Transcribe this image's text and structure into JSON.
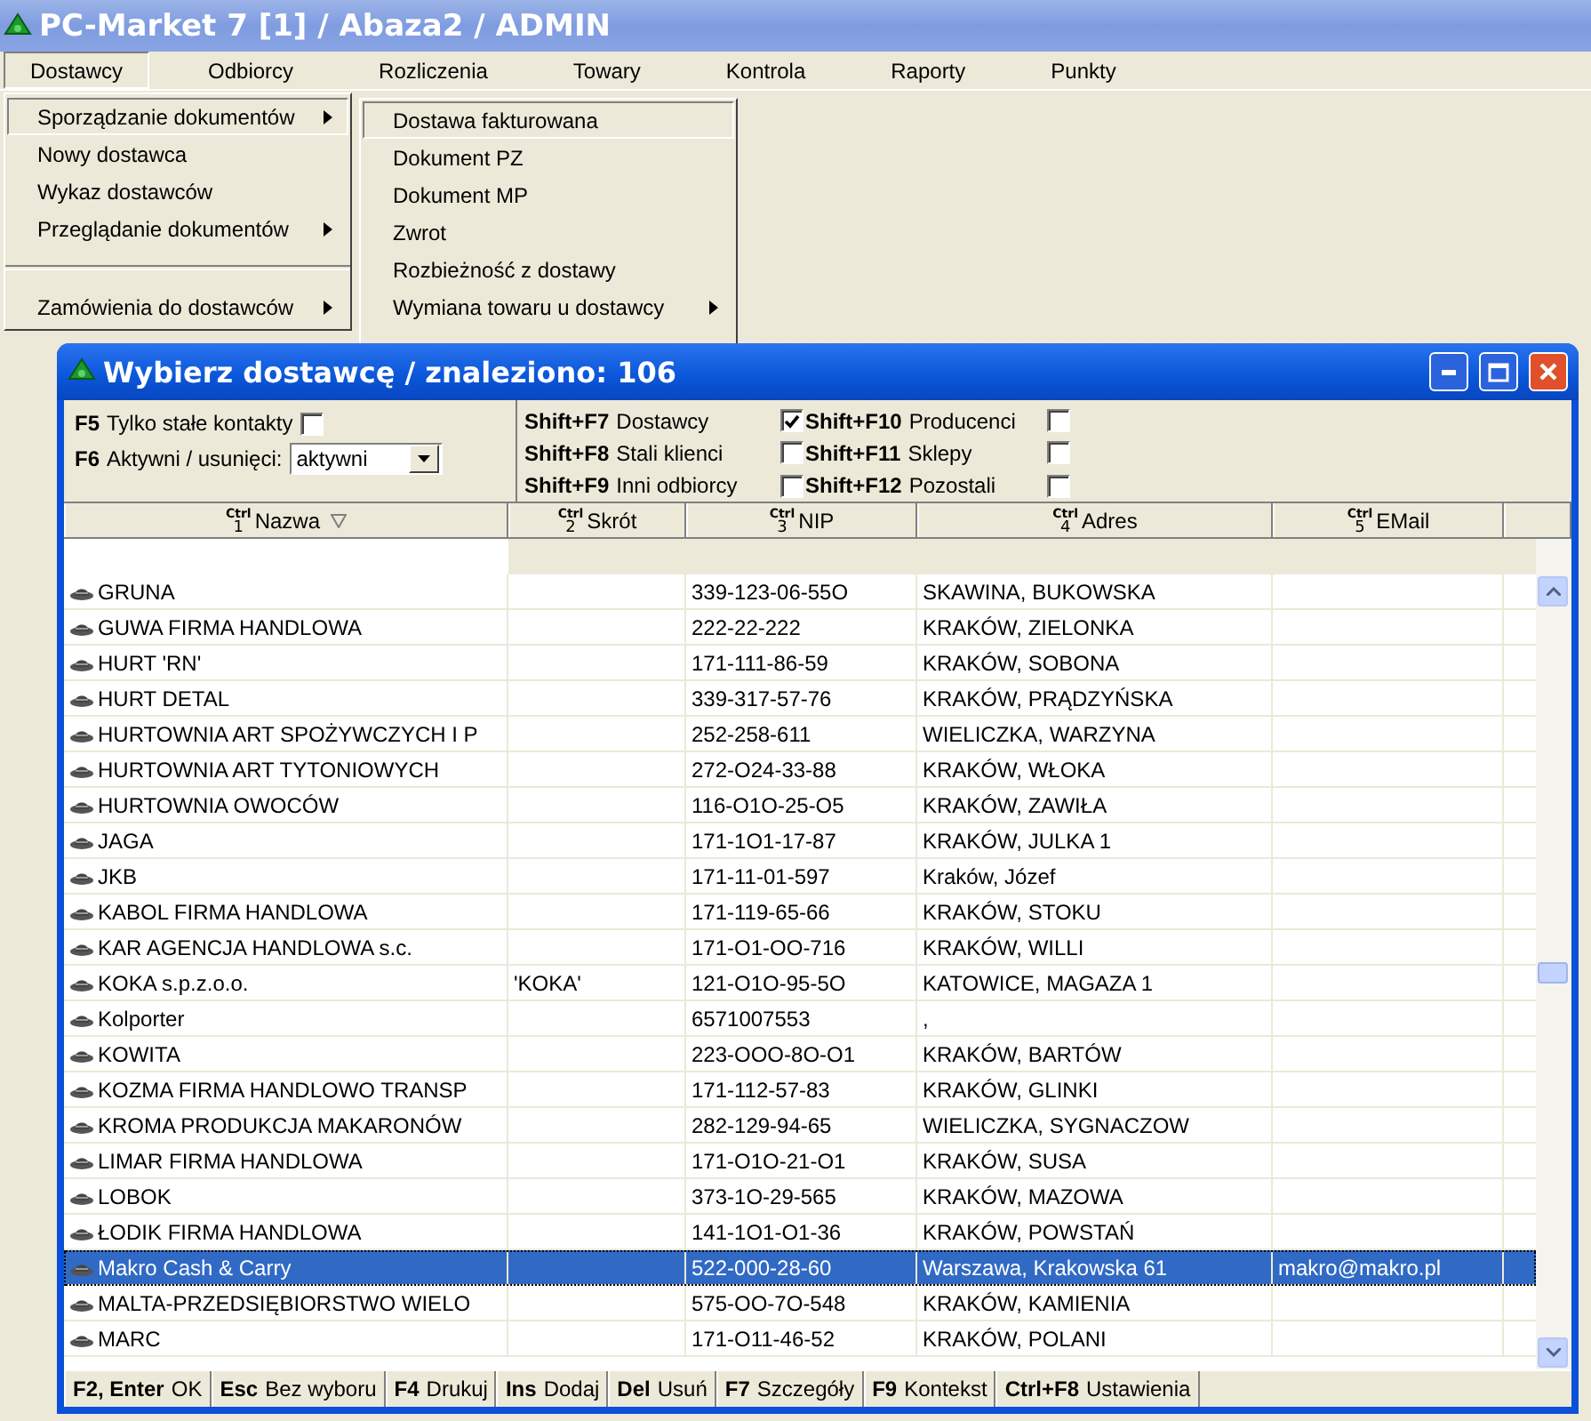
{
  "window": {
    "title": "PC-Market 7 [1] / Abaza2 / ADMIN"
  },
  "menubar": [
    {
      "label": "Dostawcy",
      "selected": true
    },
    {
      "label": "Odbiorcy",
      "selected": false
    },
    {
      "label": "Rozliczenia",
      "selected": false
    },
    {
      "label": "Towary",
      "selected": false
    },
    {
      "label": "Kontrola",
      "selected": false
    },
    {
      "label": "Raporty",
      "selected": false
    },
    {
      "label": "Punkty",
      "selected": false
    }
  ],
  "menu": [
    {
      "kind": "item",
      "label": "Sporządzanie dokumentów",
      "submenu": true,
      "selected": true
    },
    {
      "kind": "item",
      "label": "Nowy dostawca",
      "submenu": false,
      "selected": false
    },
    {
      "kind": "item",
      "label": "Wykaz dostawców",
      "submenu": false,
      "selected": false
    },
    {
      "kind": "item",
      "label": "Przeglądanie dokumentów",
      "submenu": true,
      "selected": false
    },
    {
      "kind": "separator"
    },
    {
      "kind": "item",
      "label": "Zamówienia do dostawców",
      "submenu": true,
      "selected": false
    }
  ],
  "submenu": [
    {
      "label": "Dostawa fakturowana",
      "submenu": false,
      "selected": true
    },
    {
      "label": "Dokument PZ",
      "submenu": false,
      "selected": false
    },
    {
      "label": "Dokument MP",
      "submenu": false,
      "selected": false
    },
    {
      "label": "Zwrot",
      "submenu": false,
      "selected": false
    },
    {
      "label": "Rozbieżność z dostawy",
      "submenu": false,
      "selected": false
    },
    {
      "label": "Wymiana towaru u dostawcy",
      "submenu": true,
      "selected": false
    }
  ],
  "dialog": {
    "title": "Wybierz dostawcę / znaleziono: 106",
    "filters": {
      "only_constant": {
        "key": "F5",
        "label": "Tylko stałe kontakty",
        "checked": false
      },
      "active": {
        "key": "F6",
        "label": "Aktywni / usunięci:",
        "value": "aktywni"
      },
      "types": [
        {
          "key": "Shift+F7",
          "label": "Dostawcy",
          "checked": true
        },
        {
          "key": "Shift+F10",
          "label": "Producenci",
          "checked": false
        },
        {
          "key": "Shift+F8",
          "label": "Stali klienci",
          "checked": false
        },
        {
          "key": "Shift+F11",
          "label": "Sklepy",
          "checked": false
        },
        {
          "key": "Shift+F9",
          "label": "Inni odbiorcy",
          "checked": false
        },
        {
          "key": "Shift+F12",
          "label": "Pozostali",
          "checked": false
        }
      ]
    },
    "columns": [
      {
        "ctrl": "Ctrl",
        "num": "1",
        "label": "Nazwa",
        "sorted": true
      },
      {
        "ctrl": "Ctrl",
        "num": "2",
        "label": "Skrót",
        "sorted": false
      },
      {
        "ctrl": "Ctrl",
        "num": "3",
        "label": "NIP",
        "sorted": false
      },
      {
        "ctrl": "Ctrl",
        "num": "4",
        "label": "Adres",
        "sorted": false
      },
      {
        "ctrl": "Ctrl",
        "num": "5",
        "label": "EMail",
        "sorted": false
      }
    ],
    "rows": [
      {
        "cells": [
          "GRUNA",
          "",
          "339-123-06-55O",
          "SKAWINA, BUKOWSKA",
          ""
        ],
        "selected": false
      },
      {
        "cells": [
          "GUWA FIRMA HANDLOWA",
          "",
          "222-22-222",
          "KRAKÓW, ZIELONKA",
          ""
        ],
        "selected": false
      },
      {
        "cells": [
          "HURT 'RN'",
          "",
          "171-111-86-59",
          "KRAKÓW, SOBONA",
          ""
        ],
        "selected": false
      },
      {
        "cells": [
          "HURT DETAL",
          "",
          "339-317-57-76",
          "KRAKÓW, PRĄDZYŃSKA",
          ""
        ],
        "selected": false
      },
      {
        "cells": [
          "HURTOWNIA ART SPOŻYWCZYCH I P",
          "",
          "252-258-611",
          "WIELICZKA, WARZYNA",
          ""
        ],
        "selected": false
      },
      {
        "cells": [
          "HURTOWNIA ART TYTONIOWYCH",
          "",
          "272-O24-33-88",
          "KRAKÓW, WŁOKA",
          ""
        ],
        "selected": false
      },
      {
        "cells": [
          "HURTOWNIA OWOCÓW",
          "",
          "116-O1O-25-O5",
          "KRAKÓW, ZAWIŁA",
          ""
        ],
        "selected": false
      },
      {
        "cells": [
          "JAGA",
          "",
          "171-1O1-17-87",
          "KRAKÓW, JULKA 1",
          ""
        ],
        "selected": false
      },
      {
        "cells": [
          "JKB",
          "",
          "171-11-01-597",
          "Kraków, Józef",
          ""
        ],
        "selected": false
      },
      {
        "cells": [
          "KABOL FIRMA HANDLOWA",
          "",
          "171-119-65-66",
          "KRAKÓW, STOKU",
          ""
        ],
        "selected": false
      },
      {
        "cells": [
          "KAR AGENCJA HANDLOWA s.c.",
          "",
          "171-O1-OO-716",
          "KRAKÓW, WILLI",
          ""
        ],
        "selected": false
      },
      {
        "cells": [
          "KOKA s.p.z.o.o.",
          "'KOKA'",
          "121-O1O-95-5O",
          "KATOWICE, MAGAZA 1",
          ""
        ],
        "selected": false
      },
      {
        "cells": [
          "Kolporter",
          "",
          "6571007553",
          ",",
          ""
        ],
        "selected": false
      },
      {
        "cells": [
          "KOWITA",
          "",
          "223-OOO-8O-O1",
          "KRAKÓW, BARTÓW",
          ""
        ],
        "selected": false
      },
      {
        "cells": [
          "KOZMA FIRMA HANDLOWO TRANSP",
          "",
          "171-112-57-83",
          "KRAKÓW, GLINKI",
          ""
        ],
        "selected": false
      },
      {
        "cells": [
          "KROMA PRODUKCJA MAKARONÓW",
          "",
          "282-129-94-65",
          "WIELICZKA, SYGNACZOW",
          ""
        ],
        "selected": false
      },
      {
        "cells": [
          "LIMAR FIRMA HANDLOWA",
          "",
          "171-O1O-21-O1",
          "KRAKÓW, SUSA",
          ""
        ],
        "selected": false
      },
      {
        "cells": [
          "LOBOK",
          "",
          "373-1O-29-565",
          "KRAKÓW, MAZOWA",
          ""
        ],
        "selected": false
      },
      {
        "cells": [
          "ŁODIK FIRMA HANDLOWA",
          "",
          "141-1O1-O1-36",
          "KRAKÓW, POWSTAŃ",
          ""
        ],
        "selected": false
      },
      {
        "cells": [
          "Makro Cash & Carry",
          "",
          "522-000-28-60",
          "Warszawa, Krakowska 61",
          "makro@makro.pl"
        ],
        "selected": true
      },
      {
        "cells": [
          "MALTA-PRZEDSIĘBIORSTWO WIELO",
          "",
          "575-OO-7O-548",
          "KRAKÓW, KAMIENIA",
          ""
        ],
        "selected": false
      },
      {
        "cells": [
          "MARC",
          "",
          "171-O11-46-52",
          "KRAKÓW, POLANI",
          ""
        ],
        "selected": false
      }
    ],
    "status_bar": [
      {
        "key": "F2, Enter",
        "label": "OK"
      },
      {
        "key": "Esc",
        "label": "Bez wyboru"
      },
      {
        "key": "F4",
        "label": "Drukuj"
      },
      {
        "key": "Ins",
        "label": "Dodaj"
      },
      {
        "key": "Del",
        "label": "Usuń"
      },
      {
        "key": "F7",
        "label": "Szczegóły"
      },
      {
        "key": "F9",
        "label": "Kontekst"
      },
      {
        "key": "Ctrl+F8",
        "label": "Ustawienia"
      }
    ]
  }
}
